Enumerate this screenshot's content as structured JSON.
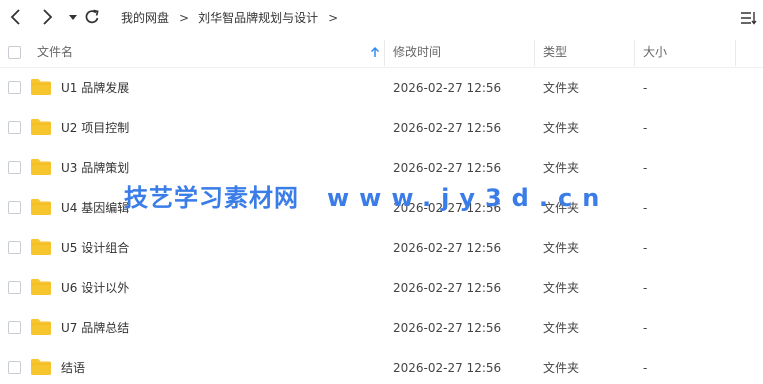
{
  "breadcrumb": {
    "root": "我的网盘",
    "current": "刘华智品牌规划与设计"
  },
  "columns": {
    "name": "文件名",
    "modified": "修改时间",
    "type": "类型",
    "size": "大小"
  },
  "files": [
    {
      "name": "U1 品牌发展",
      "modified": "2026-02-27 12:56",
      "type": "文件夹",
      "size": "-"
    },
    {
      "name": "U2 项目控制",
      "modified": "2026-02-27 12:56",
      "type": "文件夹",
      "size": "-"
    },
    {
      "name": "U3 品牌策划",
      "modified": "2026-02-27 12:56",
      "type": "文件夹",
      "size": "-"
    },
    {
      "name": "U4 基因编辑",
      "modified": "2026-02-27 12:56",
      "type": "文件夹",
      "size": "-"
    },
    {
      "name": "U5 设计组合",
      "modified": "2026-02-27 12:56",
      "type": "文件夹",
      "size": "-"
    },
    {
      "name": "U6 设计以外",
      "modified": "2026-02-27 12:56",
      "type": "文件夹",
      "size": "-"
    },
    {
      "name": "U7 品牌总结",
      "modified": "2026-02-27 12:56",
      "type": "文件夹",
      "size": "-"
    },
    {
      "name": "结语",
      "modified": "2026-02-27 12:56",
      "type": "文件夹",
      "size": "-"
    }
  ],
  "watermark": {
    "title": "技艺学习素材网",
    "url": "www.jy3d.cn"
  },
  "colors": {
    "folder": "#f7c62f",
    "accent": "#3b7de8",
    "sort_arrow": "#2f8cf0"
  },
  "icons": {
    "back": "chevron-left-icon",
    "forward": "chevron-right-icon",
    "history": "caret-down-icon",
    "refresh": "refresh-icon",
    "view": "list-view-icon",
    "sort": "sort-ascending-icon",
    "folder": "folder-icon"
  }
}
